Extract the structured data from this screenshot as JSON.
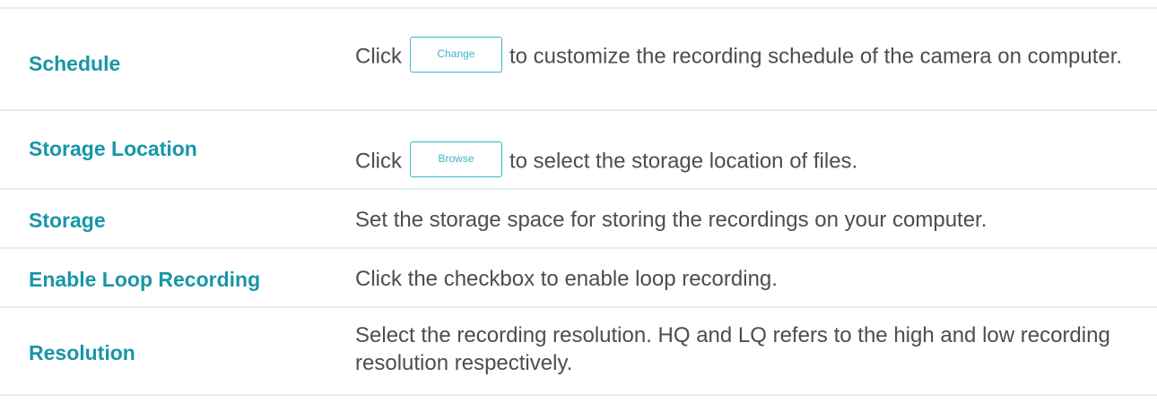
{
  "rows": [
    {
      "label": "Schedule",
      "desc_before": "Click",
      "button_label": "Change",
      "desc_after": "to customize the recording schedule of the camera on computer."
    },
    {
      "label": "Storage Location",
      "desc_before": "Click",
      "button_label": "Browse",
      "desc_after": "to select the storage location of files."
    },
    {
      "label": "Storage",
      "desc": "Set the storage space for storing the recordings on your computer."
    },
    {
      "label": "Enable Loop Recording",
      "desc": "Click the checkbox to enable loop recording."
    },
    {
      "label": "Resolution",
      "desc": "Select the recording resolution. HQ and LQ refers to the high and low recording resolution respectively."
    }
  ],
  "colors": {
    "label": "#1896a8",
    "text": "#4d4d4d",
    "divider": "#e3edf3",
    "button_border": "#3ab7c7"
  }
}
